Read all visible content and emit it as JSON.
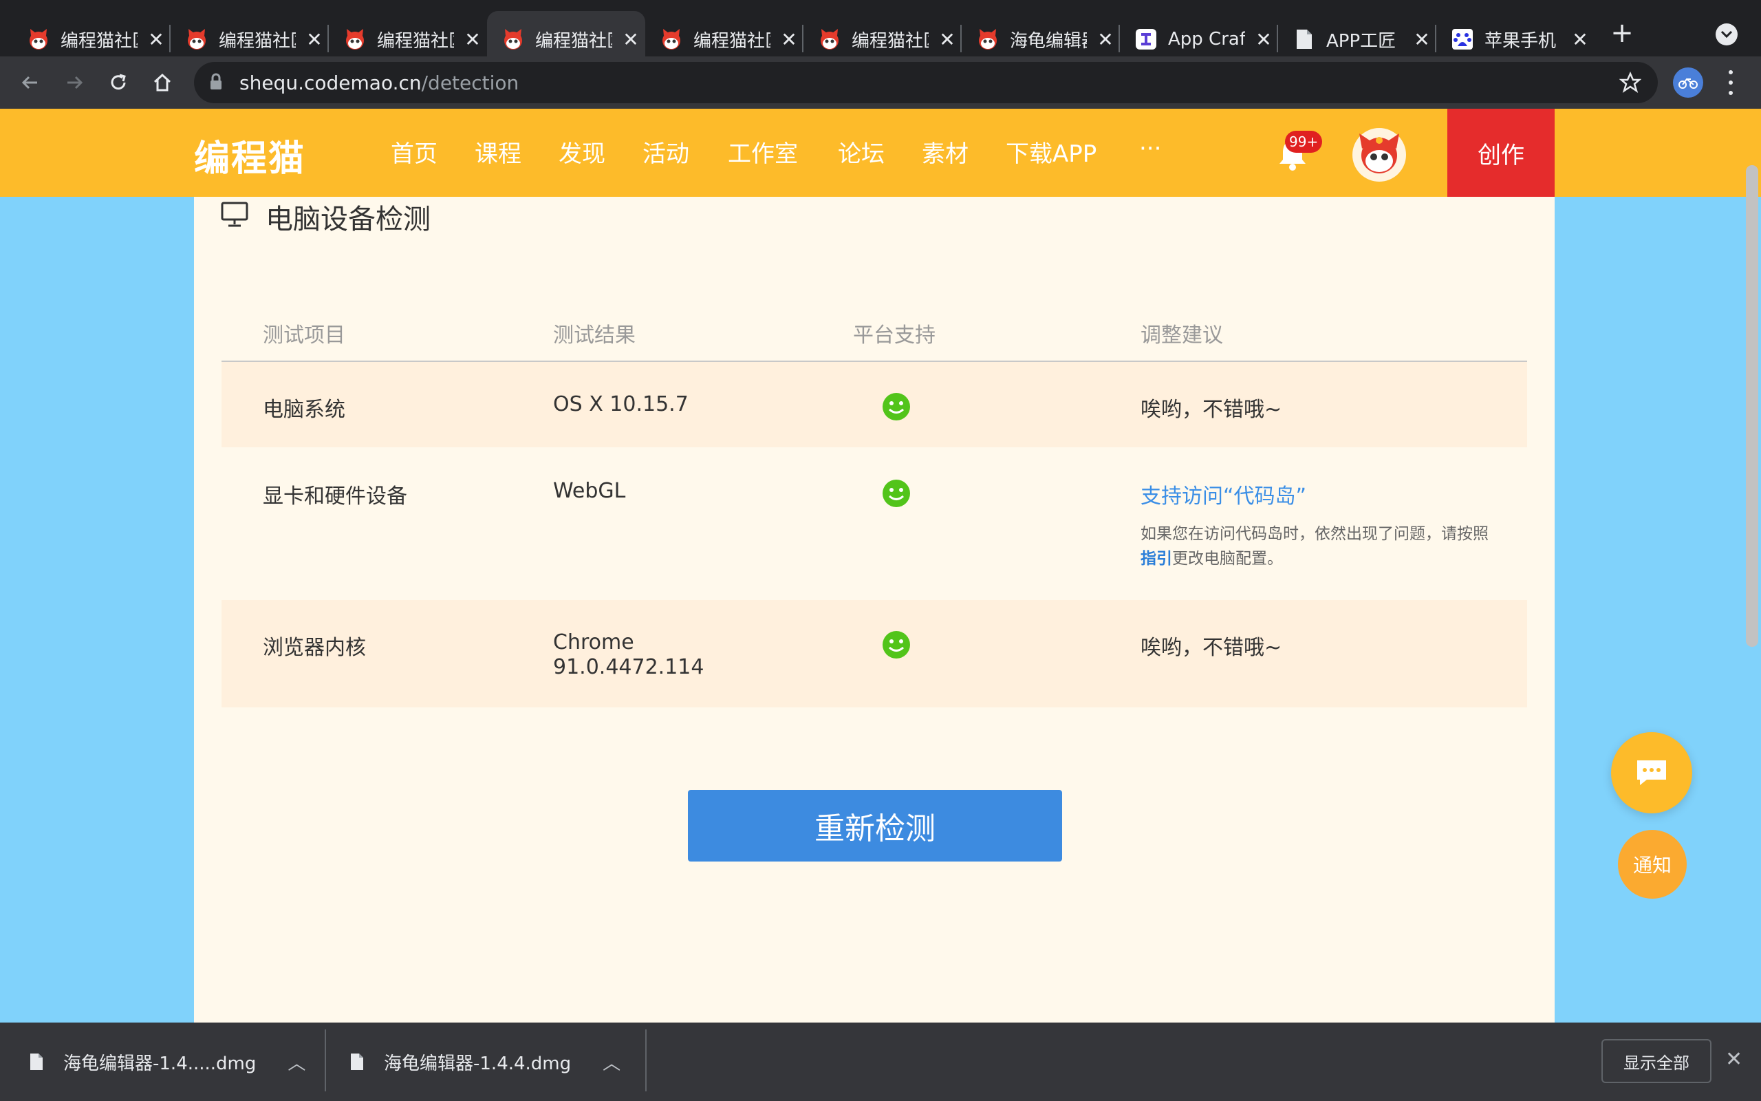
{
  "browser": {
    "tabs": [
      {
        "title": "编程猫社区",
        "icon": "codemao-favicon"
      },
      {
        "title": "编程猫社区",
        "icon": "codemao-favicon"
      },
      {
        "title": "编程猫社区",
        "icon": "codemao-favicon"
      },
      {
        "title": "编程猫社区",
        "icon": "codemao-favicon",
        "active": true
      },
      {
        "title": "编程猫社区",
        "icon": "codemao-favicon"
      },
      {
        "title": "编程猫社区",
        "icon": "codemao-favicon"
      },
      {
        "title": "海龟编辑器",
        "icon": "codemao-favicon"
      },
      {
        "title": "App Craft",
        "icon": "appcraft-favicon"
      },
      {
        "title": "APP工匠",
        "icon": "document-icon"
      },
      {
        "title": "苹果手机",
        "icon": "baidu-favicon"
      }
    ],
    "url_host": "shequ.codemao.cn",
    "url_path": "/detection"
  },
  "header": {
    "logo": "编程猫",
    "nav": [
      "首页",
      "课程",
      "发现",
      "活动",
      "工作室",
      "论坛",
      "素材",
      "下载APP",
      "···"
    ],
    "notification_badge": "99+",
    "create_label": "创作"
  },
  "main": {
    "section_title": "电脑设备检测",
    "columns": [
      "测试项目",
      "测试结果",
      "平台支持",
      "调整建议"
    ],
    "rows": [
      {
        "item": "电脑系统",
        "result": "OS X 10.15.7",
        "supported": true,
        "advice": "唉哟，不错哦~"
      },
      {
        "item": "显卡和硬件设备",
        "result": "WebGL",
        "supported": true,
        "advice_link": "支持访问“代码岛”",
        "advice_note_pre": "如果您在访问代码岛时，依然出现了问题，请按照",
        "advice_note_link": "指引",
        "advice_note_post": "更改电脑配置。"
      },
      {
        "item": "浏览器内核",
        "result_line1": "Chrome",
        "result_line2": "91.0.4472.114",
        "supported": true,
        "advice": "唉哟，不错哦~"
      }
    ],
    "recheck_button": "重新检测"
  },
  "float": {
    "notice_label": "通知"
  },
  "downloads": {
    "items": [
      "海龟编辑器-1.4.....dmg",
      "海龟编辑器-1.4.4.dmg"
    ],
    "show_all": "显示全部"
  },
  "colors": {
    "brand": "#fdbb2a",
    "create": "#e52c2c",
    "primary_button": "#3d8be0",
    "support_ok": "#52c41a",
    "page_bg": "#80d2fb"
  }
}
